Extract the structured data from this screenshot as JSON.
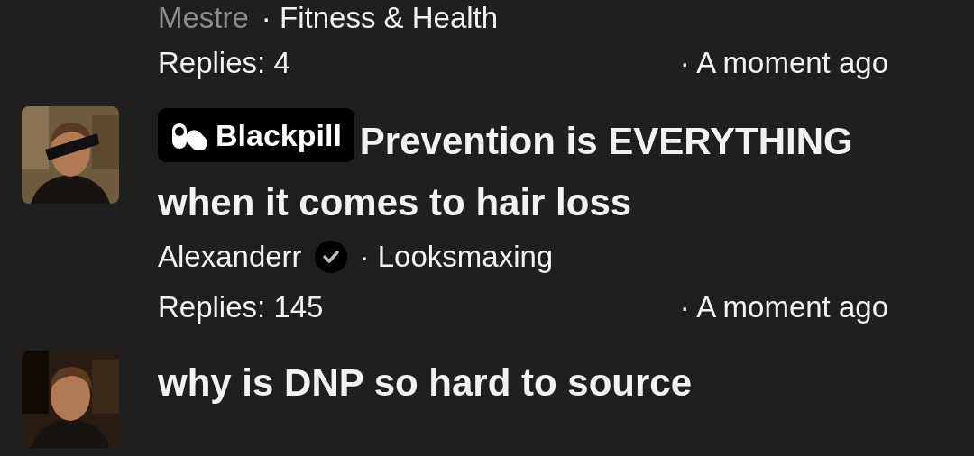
{
  "posts": [
    {
      "author": "Mestre",
      "author_dimmed": true,
      "verified": false,
      "category": "· Fitness & Health",
      "replies": "Replies: 4",
      "time": "· A moment ago"
    },
    {
      "tag": "Blackpill",
      "title": "Prevention is EVERYTHING when it comes to hair loss",
      "author": "Alexanderr",
      "author_dimmed": false,
      "verified": true,
      "category": "· Looksmaxing",
      "replies": "Replies: 145",
      "time": "· A moment ago"
    },
    {
      "title": "why is DNP so hard to source"
    }
  ]
}
